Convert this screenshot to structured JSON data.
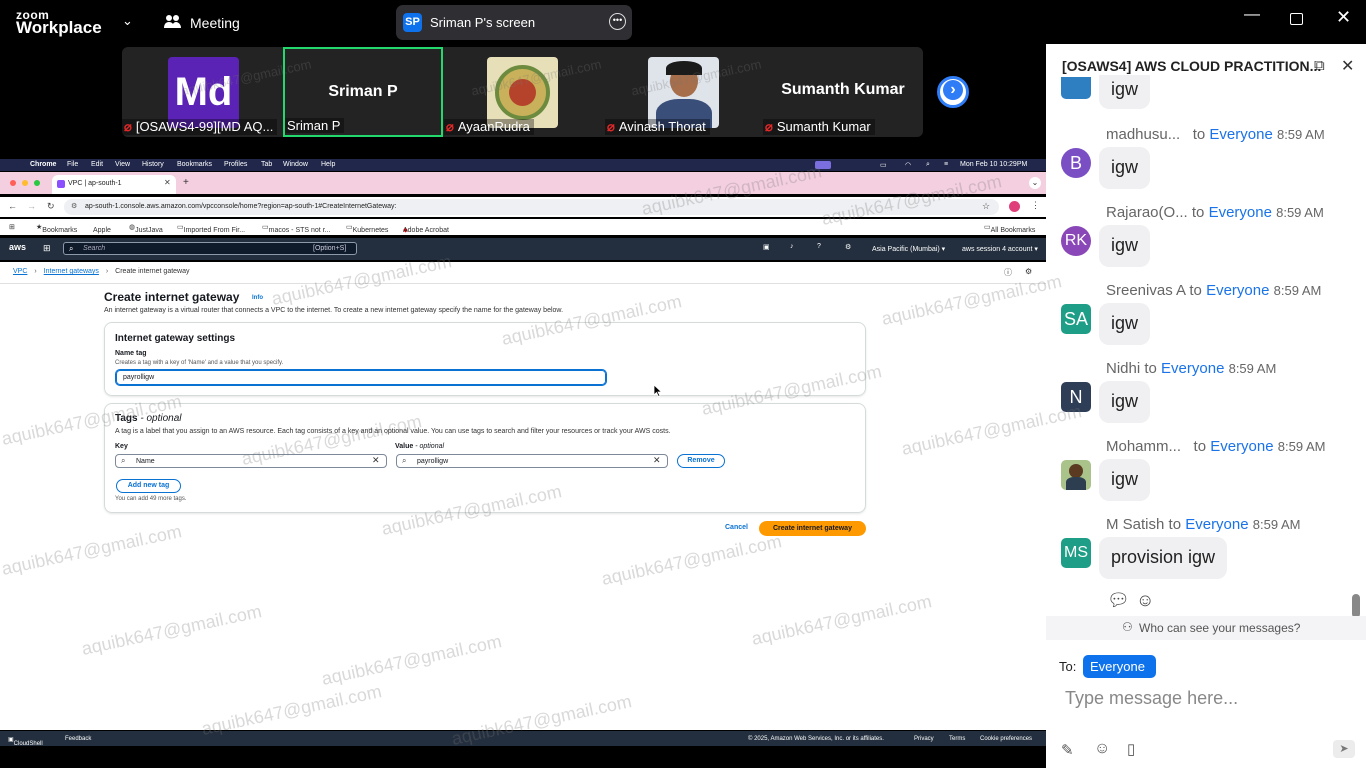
{
  "zoom": {
    "logo_line1": "zoom",
    "logo_line2": "Workplace",
    "meeting_label": "Meeting",
    "share_badge": "SP",
    "share_title": "Sriman P's screen",
    "window_controls": [
      "minimize-icon",
      "restore-icon",
      "close-icon"
    ]
  },
  "gallery": [
    {
      "name": "[OSAWS4-99][MD AQ...",
      "avatar_text": "Md",
      "muted": true
    },
    {
      "name": "Sriman P",
      "big_name": "Sriman P",
      "muted": false,
      "active": true
    },
    {
      "name": "AyaanRudra",
      "muted": true
    },
    {
      "name": "Avinash Thorat",
      "muted": true
    },
    {
      "name": "Sumanth Kumar",
      "big_name": "Sumanth Kumar",
      "muted": true
    }
  ],
  "mac": {
    "menu": [
      "Chrome",
      "File",
      "Edit",
      "View",
      "History",
      "Bookmarks",
      "Profiles",
      "Tab",
      "Window",
      "Help"
    ],
    "clock": "Mon Feb 10  10:29PM"
  },
  "browser": {
    "tab_title": "VPC | ap-south-1",
    "url": "ap-south-1.console.aws.amazon.com/vpcconsole/home?region=ap-south-1#CreateInternetGateway:",
    "bookmarks": [
      "Bookmarks",
      "Apple",
      "JustJava",
      "Imported From Fir...",
      "macos - STS not r...",
      "Kubernetes",
      "Adobe Acrobat"
    ],
    "all_bookmarks": "All Bookmarks"
  },
  "aws": {
    "logo": "aws",
    "search_placeholder": "Search",
    "search_shortcut": "[Option+S]",
    "region": "Asia Pacific (Mumbai) ▾",
    "account": "aws session 4 account ▾",
    "breadcrumb": [
      "VPC",
      "Internet gateways",
      "Create internet gateway"
    ],
    "title": "Create internet gateway",
    "info": "Info",
    "description": "An internet gateway is a virtual router that connects a VPC to the internet. To create a new internet gateway specify the name for the gateway below.",
    "settings_title": "Internet gateway settings",
    "name_tag_label": "Name tag",
    "name_tag_hint": "Creates a tag with a key of 'Name' and a value that you specify.",
    "name_tag_value": "payrolligw",
    "tags_title": "Tags",
    "tags_optional": "- optional",
    "tags_desc": "A tag is a label that you assign to an AWS resource. Each tag consists of a key and an optional value. You can use tags to search and filter your resources or track your AWS costs.",
    "key_label": "Key",
    "value_label": "Value",
    "value_optional": "- optional",
    "key_value": "Name",
    "value_value": "payrolligw",
    "remove": "Remove",
    "add_tag": "Add new tag",
    "tags_hint": "You can add 49 more tags.",
    "cancel": "Cancel",
    "create": "Create internet gateway",
    "footer": {
      "cloudshell": "CloudShell",
      "feedback": "Feedback",
      "copyright": "© 2025, Amazon Web Services, Inc. or its affiliates.",
      "privacy": "Privacy",
      "terms": "Terms",
      "cookies": "Cookie preferences"
    }
  },
  "chat": {
    "title": "[OSAWS4] AWS CLOUD PRACTITION...",
    "partial_msg": "igw",
    "messages": [
      {
        "sender": "madhusu...",
        "to": "Everyone",
        "time": "8:59 AM",
        "text": "igw",
        "initials": "B",
        "color": "#7b4fc4"
      },
      {
        "sender": "Rajarao(O...",
        "to": "Everyone",
        "time": "8:59 AM",
        "text": "igw",
        "initials": "RK",
        "color": "#8a47b8"
      },
      {
        "sender": "Sreenivas A",
        "to": "Everyone",
        "time": "8:59 AM",
        "text": "igw",
        "initials": "SA",
        "color": "#1e9e86"
      },
      {
        "sender": "Nidhi",
        "to": "Everyone",
        "time": "8:59 AM",
        "text": "igw",
        "initials": "N",
        "color": "#2f3e57"
      },
      {
        "sender": "Mohamm...",
        "to": "Everyone",
        "time": "8:59 AM",
        "text": "igw",
        "initials": "",
        "color": "#6b8f5a"
      },
      {
        "sender": "M Satish",
        "to": "Everyone",
        "time": "8:59 AM",
        "text": "provision igw",
        "initials": "MS",
        "color": "#1e9e86"
      }
    ],
    "to_word": "to",
    "who_can_see": "Who can see your messages?",
    "to_label": "To:",
    "recipient": "Everyone",
    "input_placeholder": "Type message here..."
  },
  "watermark": "aquibk647@gmail.com"
}
